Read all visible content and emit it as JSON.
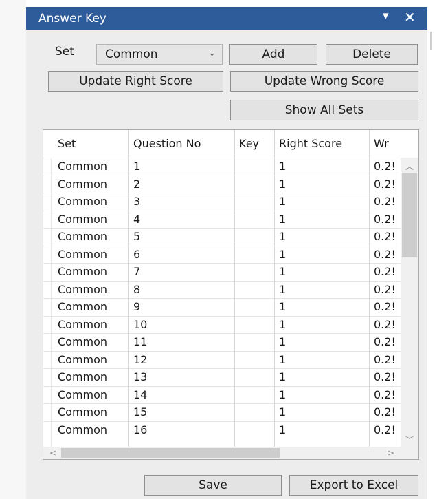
{
  "window": {
    "title": "Answer Key",
    "pin_glyph": "▾",
    "close_glyph": "✕"
  },
  "controls": {
    "set_label": "Set",
    "set_selected": "Common",
    "add_label": "Add",
    "delete_label": "Delete",
    "update_right_label": "Update Right Score",
    "update_wrong_label": "Update Wrong Score",
    "show_all_label": "Show All Sets"
  },
  "grid": {
    "columns": [
      "Set",
      "Question No",
      "Key",
      "Right Score",
      "Wr"
    ],
    "rows": [
      [
        "Common",
        "1",
        "",
        "1",
        "0.2!"
      ],
      [
        "Common",
        "2",
        "",
        "1",
        "0.2!"
      ],
      [
        "Common",
        "3",
        "",
        "1",
        "0.2!"
      ],
      [
        "Common",
        "4",
        "",
        "1",
        "0.2!"
      ],
      [
        "Common",
        "5",
        "",
        "1",
        "0.2!"
      ],
      [
        "Common",
        "6",
        "",
        "1",
        "0.2!"
      ],
      [
        "Common",
        "7",
        "",
        "1",
        "0.2!"
      ],
      [
        "Common",
        "8",
        "",
        "1",
        "0.2!"
      ],
      [
        "Common",
        "9",
        "",
        "1",
        "0.2!"
      ],
      [
        "Common",
        "10",
        "",
        "1",
        "0.2!"
      ],
      [
        "Common",
        "11",
        "",
        "1",
        "0.2!"
      ],
      [
        "Common",
        "12",
        "",
        "1",
        "0.2!"
      ],
      [
        "Common",
        "13",
        "",
        "1",
        "0.2!"
      ],
      [
        "Common",
        "14",
        "",
        "1",
        "0.2!"
      ],
      [
        "Common",
        "15",
        "",
        "1",
        "0.2!"
      ],
      [
        "Common",
        "16",
        "",
        "1",
        "0.2!"
      ]
    ]
  },
  "scrollbars": {
    "up": "︿",
    "down": "﹀",
    "left": "<",
    "right": ">"
  },
  "footer": {
    "save_label": "Save",
    "export_label": "Export to Excel"
  }
}
